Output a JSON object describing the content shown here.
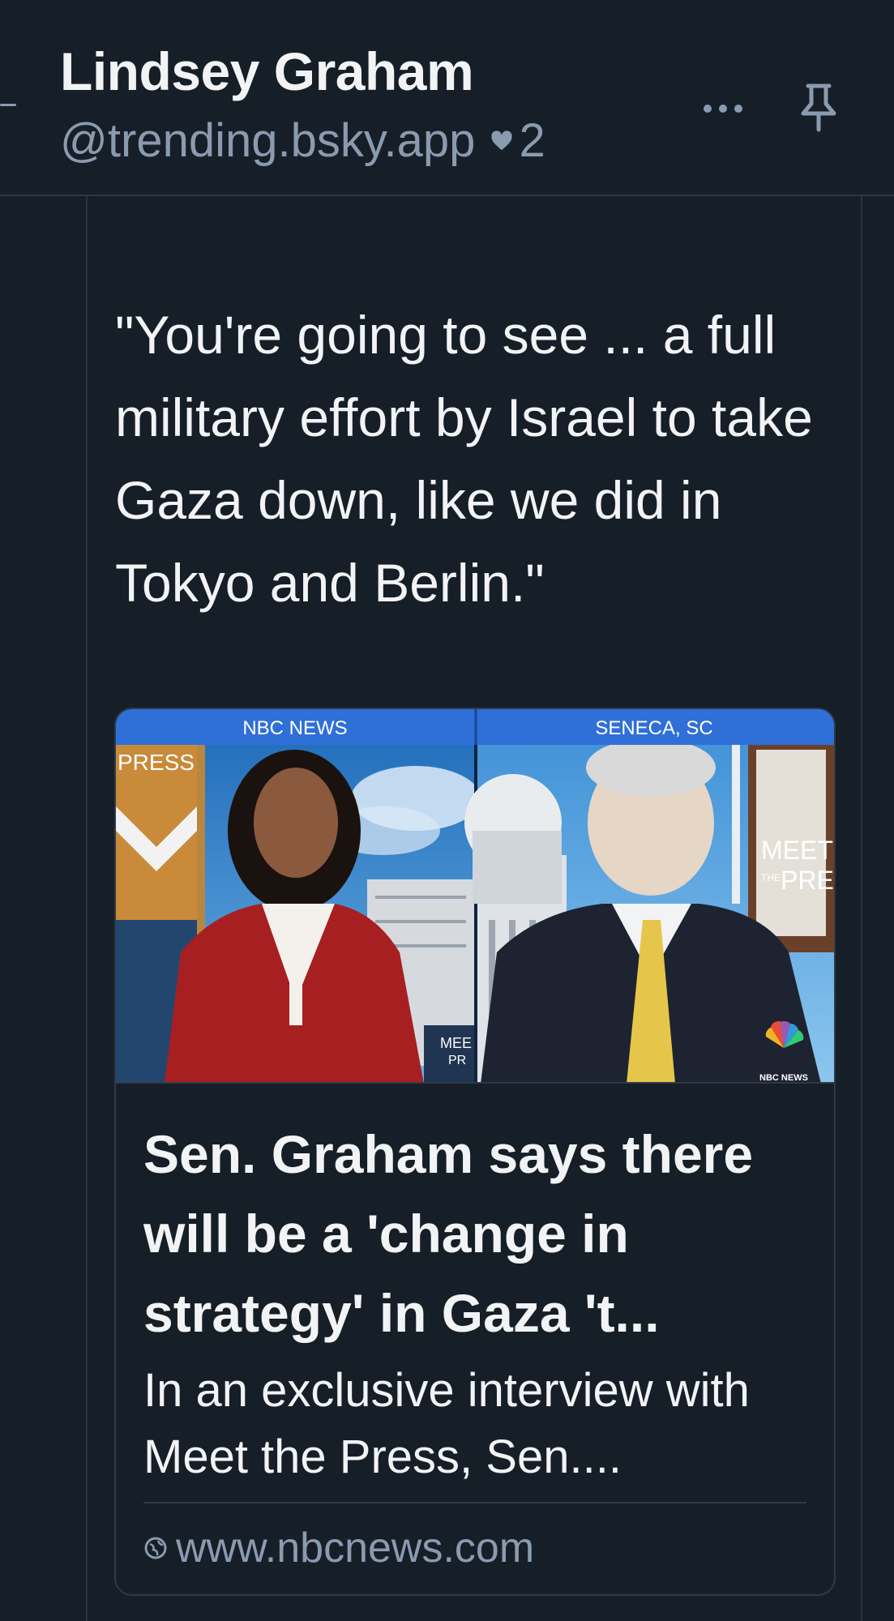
{
  "header": {
    "title": "Lindsey Graham",
    "handle": "@trending.bsky.app",
    "like_count": "2"
  },
  "post": {
    "text": "\"You're going to see ... a full military effort by Israel to take Gaza down, like we did in Tokyo and Berlin.\""
  },
  "link_card": {
    "image": {
      "left_banner": "NBC NEWS",
      "right_banner": "SENECA, SC",
      "left_bg_logo": "PRESS",
      "right_bg_logo_top": "MEET",
      "right_bg_logo_small": "THE",
      "right_bg_logo_bottom": "PRE",
      "corner_logo_text": "NBC NEWS",
      "lower_screen_text_top": "MEE",
      "lower_screen_text_bottom": "PR"
    },
    "title": "Sen. Graham says there will be a 'change in strategy' in Gaza 't...",
    "description": "In an exclusive interview with Meet the Press, Sen....",
    "domain": "www.nbcnews.com"
  },
  "colors": {
    "background": "#161e27",
    "text_primary": "#f1f3f5",
    "text_secondary": "#8a9bb0",
    "border": "#2e3a48",
    "banner_blue": "#2f6fd8"
  },
  "icons": {
    "heart": "heart-icon",
    "menu": "ellipsis-icon",
    "pin": "pin-icon",
    "globe": "globe-icon",
    "peacock": "nbc-peacock-icon"
  }
}
